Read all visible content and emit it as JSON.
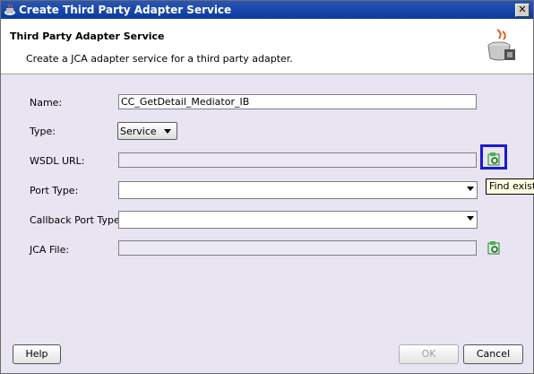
{
  "window": {
    "title": "Create Third Party Adapter Service",
    "close_symbol": "✕"
  },
  "header": {
    "title": "Third Party Adapter Service",
    "description": "Create a JCA adapter service for a third party adapter."
  },
  "form": {
    "name_label": "Name:",
    "name_value": "CC_GetDetail_Mediator_IB",
    "type_label": "Type:",
    "type_value": "Service",
    "wsdl_label": "WSDL URL:",
    "wsdl_value": "",
    "port_type_label": "Port Type:",
    "callback_label": "Callback Port Type:",
    "jca_label": "JCA File:",
    "jca_value": ""
  },
  "tooltip": {
    "text": "Find existing"
  },
  "buttons": {
    "help": "Help",
    "ok": "OK",
    "cancel": "Cancel"
  }
}
